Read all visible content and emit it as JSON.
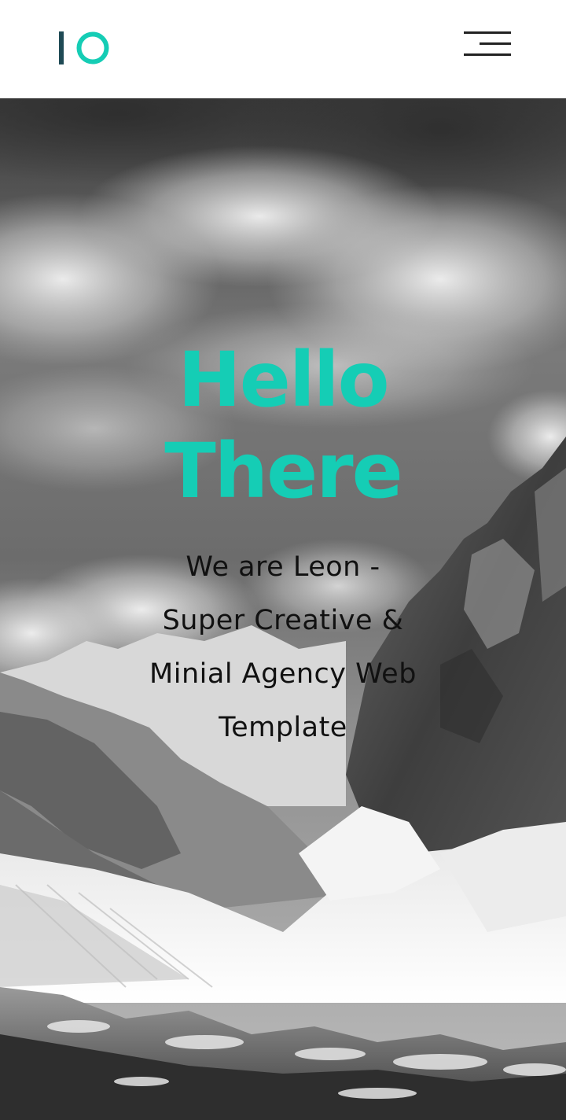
{
  "header": {
    "logo_text": "IO",
    "menu_icon": "hamburger-menu-icon"
  },
  "hero": {
    "title_line1": "Hello",
    "title_line2": "There",
    "subtitle": "We are Leon - Super Creative & Minial Agency Web Template",
    "background": "mountain-landscape-image"
  },
  "colors": {
    "accent": "#15cdb5",
    "logo_bar": "#1f4a55",
    "text_dark": "#111111",
    "header_bg": "#ffffff"
  }
}
